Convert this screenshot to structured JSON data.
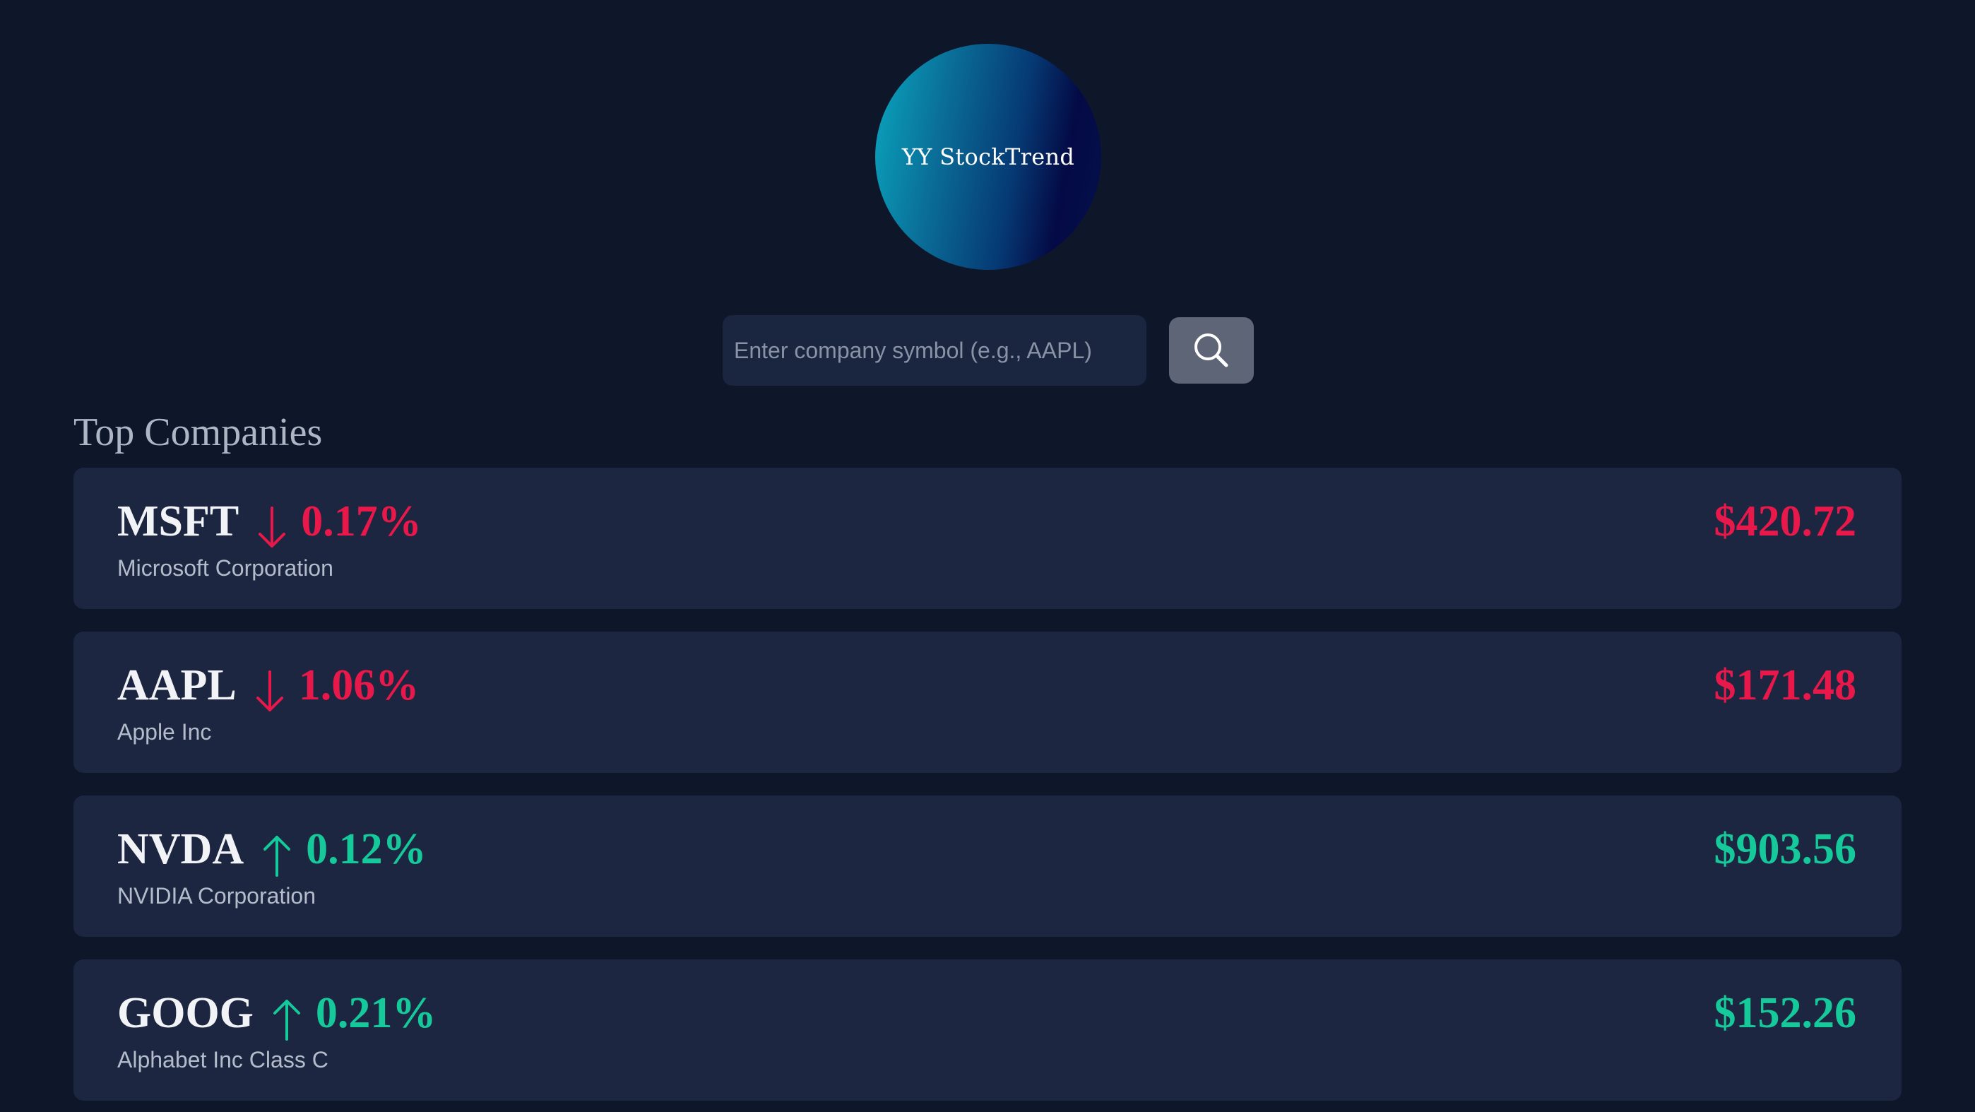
{
  "logo": {
    "text": "YY StockTrend"
  },
  "search": {
    "placeholder": "Enter company symbol (e.g., AAPL)",
    "button_icon": "search-icon"
  },
  "section": {
    "title": "Top Companies"
  },
  "colors": {
    "down": "#e8194a",
    "up": "#15c99a"
  },
  "companies": [
    {
      "symbol": "MSFT",
      "direction": "down",
      "arrow_icon": "arrow-down-icon",
      "change": "0.17%",
      "price": "$420.72",
      "name": "Microsoft Corporation"
    },
    {
      "symbol": "AAPL",
      "direction": "down",
      "arrow_icon": "arrow-down-icon",
      "change": "1.06%",
      "price": "$171.48",
      "name": "Apple Inc"
    },
    {
      "symbol": "NVDA",
      "direction": "up",
      "arrow_icon": "arrow-up-icon",
      "change": "0.12%",
      "price": "$903.56",
      "name": "NVIDIA Corporation"
    },
    {
      "symbol": "GOOG",
      "direction": "up",
      "arrow_icon": "arrow-up-icon",
      "change": "0.21%",
      "price": "$152.26",
      "name": "Alphabet Inc Class C"
    }
  ]
}
